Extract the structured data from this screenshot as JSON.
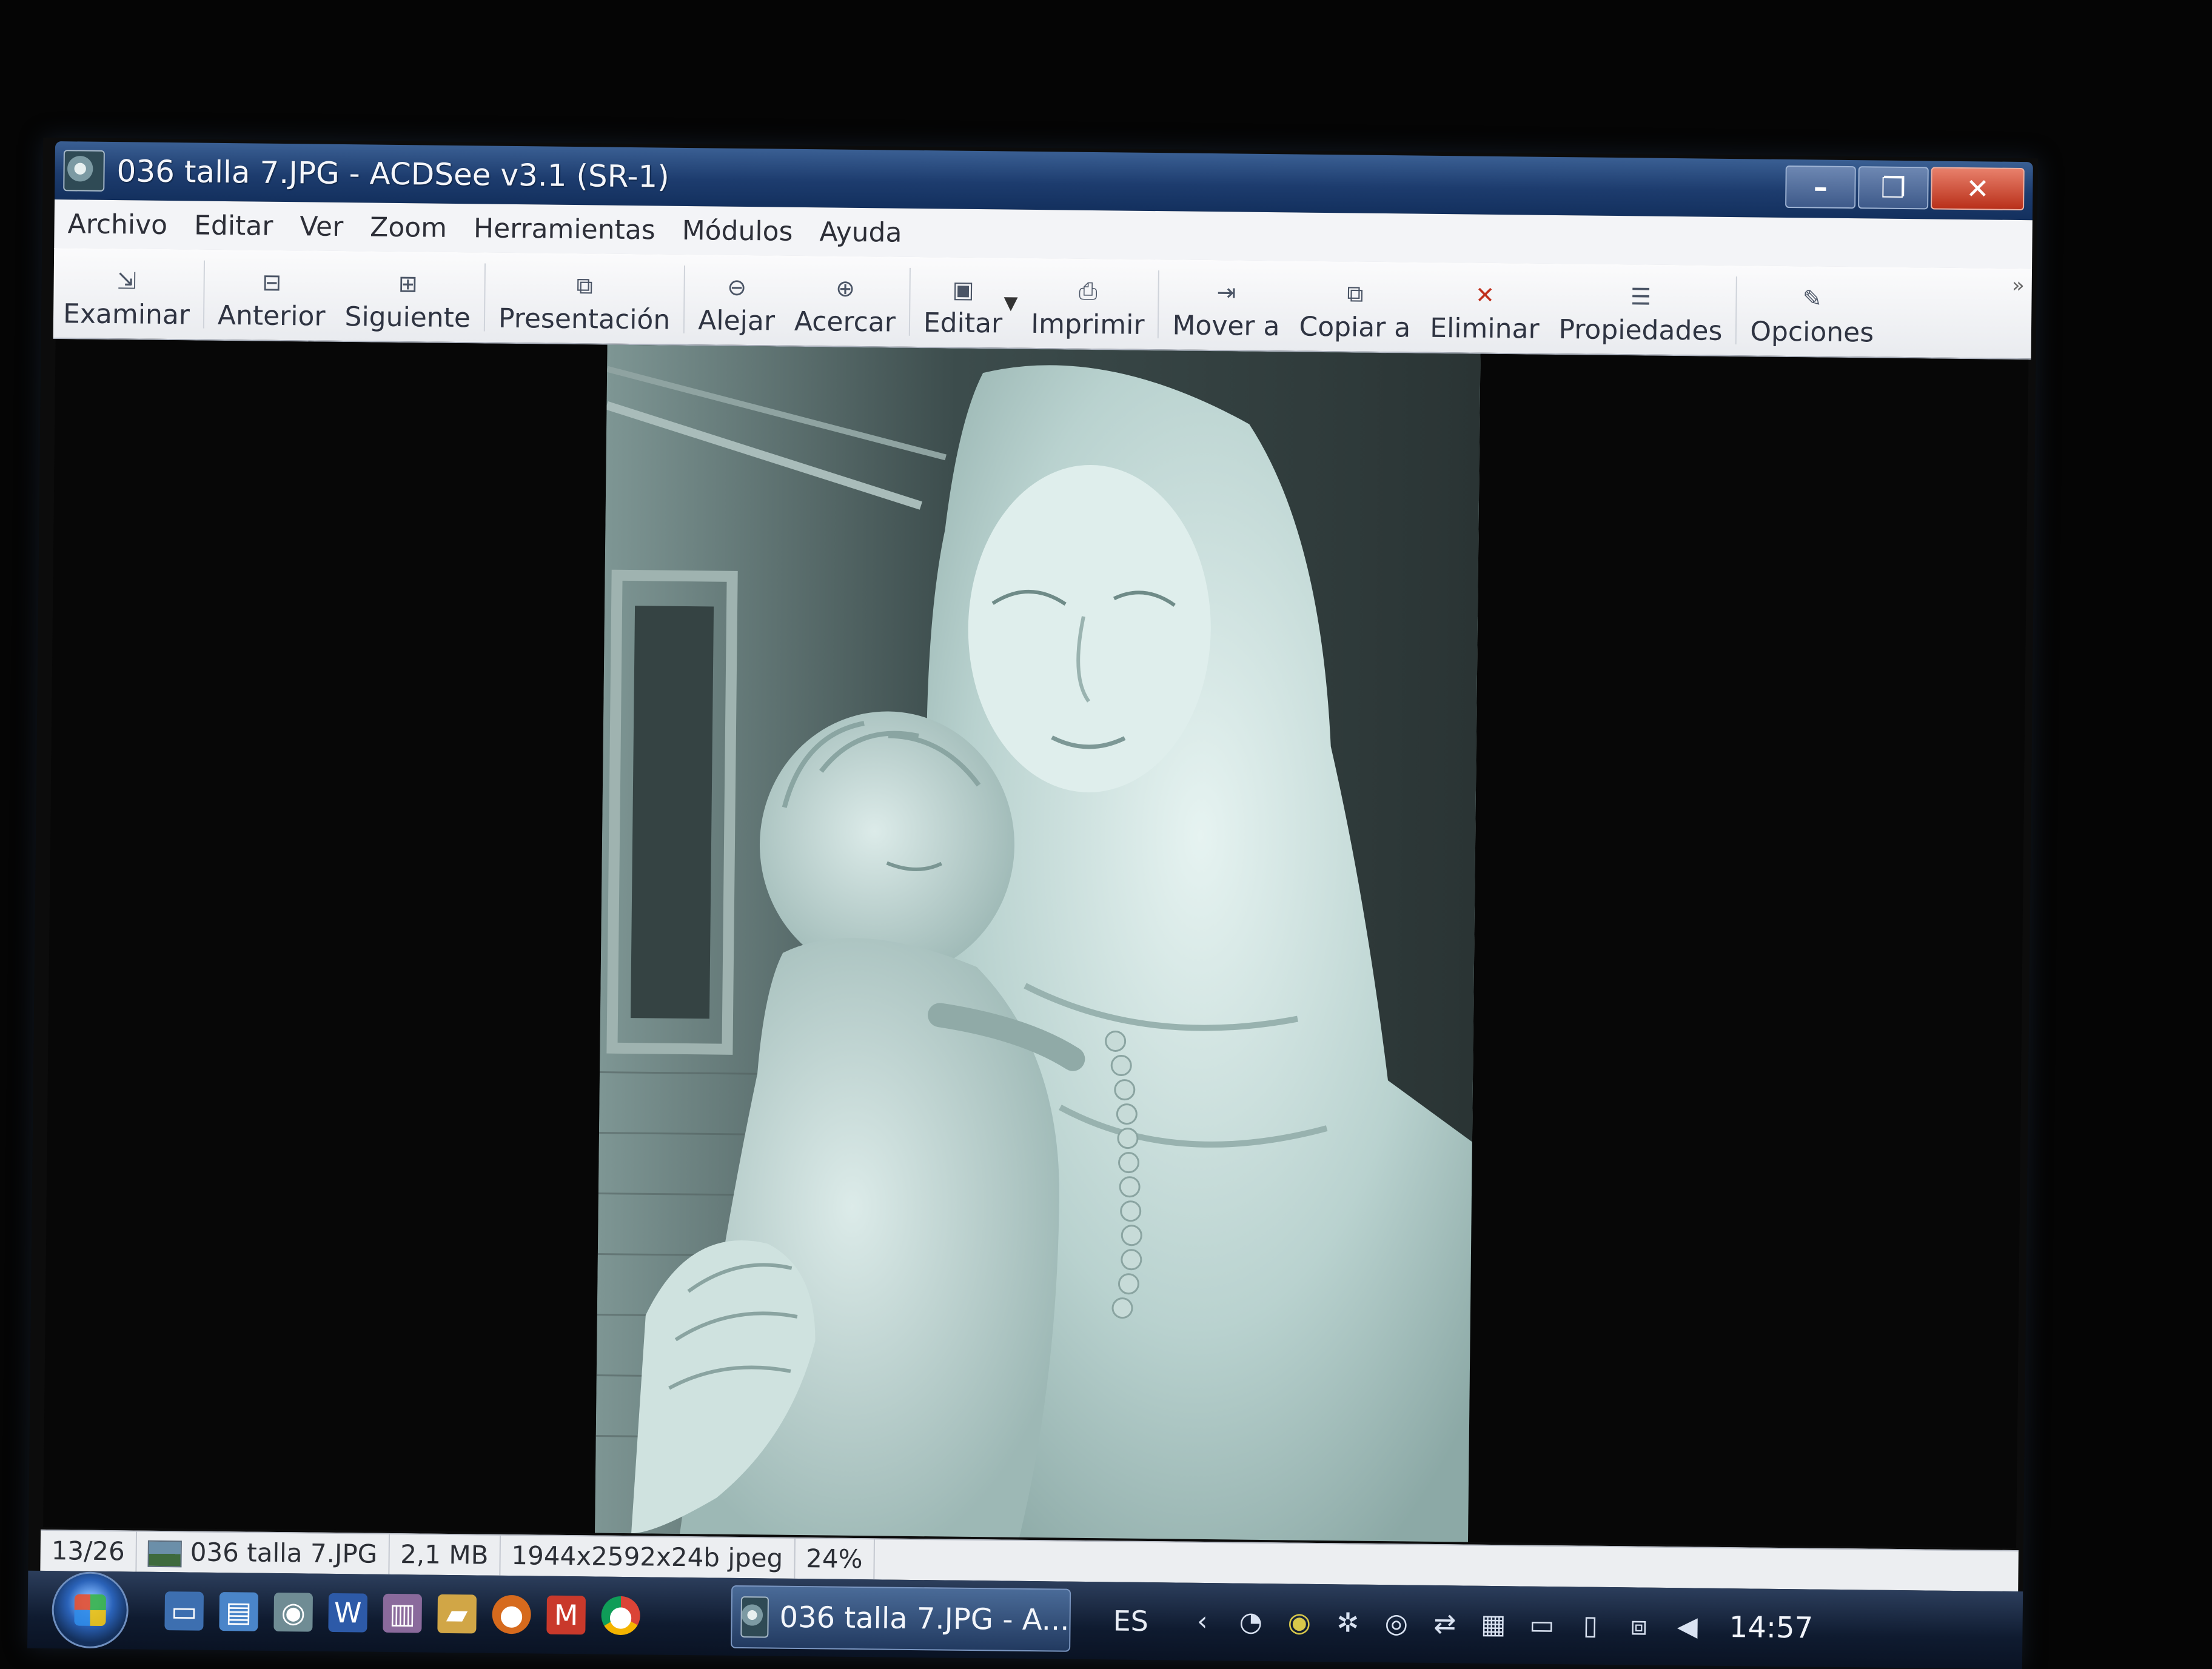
{
  "window": {
    "title": "036 talla 7.JPG - ACDSee v3.1 (SR-1)",
    "minimize_icon": "minimize-icon",
    "restore_icon": "restore-icon",
    "close_icon": "close-icon"
  },
  "menu": [
    "Archivo",
    "Editar",
    "Ver",
    "Zoom",
    "Herramientas",
    "Módulos",
    "Ayuda"
  ],
  "toolbar": {
    "examinar": "Examinar",
    "anterior": "Anterior",
    "siguiente": "Siguiente",
    "presentacion": "Presentación",
    "alejar": "Alejar",
    "acercar": "Acercar",
    "editar": "Editar",
    "imprimir": "Imprimir",
    "mover": "Mover a",
    "copiar": "Copiar a",
    "eliminar": "Eliminar",
    "propiedades": "Propiedades",
    "opciones": "Opciones",
    "more": "»"
  },
  "status": {
    "position": "13/26",
    "filename": "036 talla 7.JPG",
    "size": "2,1 MB",
    "dimensions": "1944x2592x24b jpeg",
    "zoom": "24%"
  },
  "taskbar": {
    "task_label": "036 talla 7.JPG - A...",
    "language": "ES",
    "time": "14:57"
  },
  "colors": {
    "titlebar": "#1d3c6e",
    "close_button": "#b9301a",
    "viewer_bg": "#070707"
  }
}
